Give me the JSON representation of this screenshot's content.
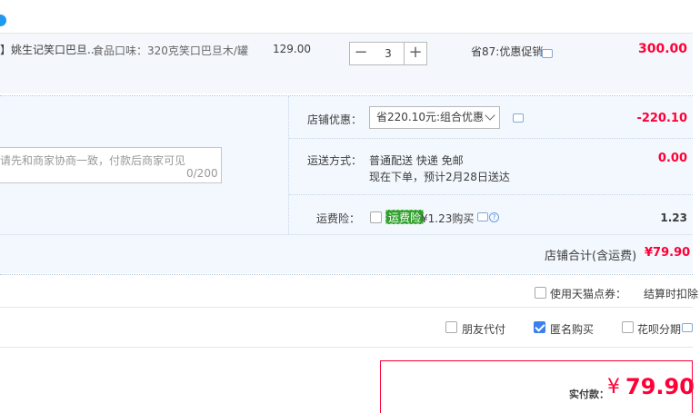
{
  "product": {
    "name": "】姚生记笑口巴旦...",
    "attribute": "食品口味：320克笑口巴旦木/罐",
    "unit_price": "129.00",
    "quantity": "3",
    "minus_label": "−",
    "plus_label": "+",
    "promo": "省87:优惠促销",
    "line_total": "300.00"
  },
  "shop_discount": {
    "label": "店铺优惠：",
    "selected": "省220.10元:组合优惠",
    "value": "-220.10"
  },
  "memo": {
    "placeholder": "请先和商家协商一致，付款后商家可见",
    "counter": "0/200"
  },
  "shipping": {
    "label": "运送方式：",
    "method": "普通配送 快递 免邮",
    "eta": "现在下单，预计2月28日送达",
    "value": "0.00"
  },
  "insurance": {
    "label": "运费险：",
    "badge": "运费险",
    "price_text": "¥1.23购买",
    "help": "?",
    "value": "1.23"
  },
  "shop_total": {
    "label": "店铺合计(含运费)",
    "value": "¥79.90"
  },
  "coupon": {
    "label": "使用天猫点券：",
    "note": "结算时扣除"
  },
  "options": {
    "friend_pay": "朋友代付",
    "anonymous": "匿名购买",
    "huabei": "花呗分期"
  },
  "payment": {
    "label": "实付款：",
    "currency": "¥",
    "amount": "79.90"
  },
  "colors": {
    "accent_red": "#ff0036",
    "checkbox_blue": "#3b80ed",
    "badge_green": "#31a02d",
    "panel_bg": "#f3f8fe"
  },
  "icons": [
    "chat-icon",
    "help-icon",
    "chevron-down-icon",
    "check-icon"
  ]
}
